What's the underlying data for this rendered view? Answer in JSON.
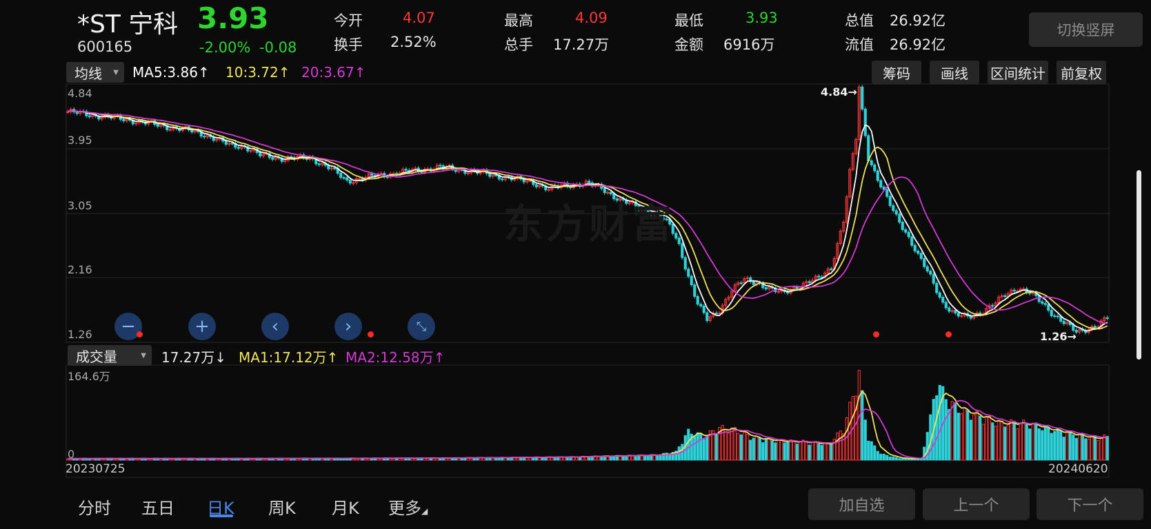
{
  "stock": {
    "name": "*ST 宁科",
    "code": "600165",
    "price": "3.93",
    "change_pct": "-2.00%",
    "change_amt": "-0.08"
  },
  "quote": {
    "open_label": "今开",
    "open": "4.07",
    "high_label": "最高",
    "high": "4.09",
    "low_label": "最低",
    "low": "3.93",
    "mktcap_label": "总值",
    "mktcap": "26.92亿",
    "turnover_label": "换手",
    "turnover": "2.52%",
    "volume_label": "总手",
    "volume": "17.27万",
    "amount_label": "金额",
    "amount": "6916万",
    "float_label": "流值",
    "float_cap": "26.92亿"
  },
  "toolbar": {
    "rotate_label": "切换竖屏",
    "ma_select": "均线",
    "ma5": "MA5:3.86",
    "ma10": "10:3.72",
    "ma20": "20:3.67",
    "chip_label": "筹码",
    "draw_label": "画线",
    "range_label": "区间统计",
    "adjust_label": "前复权"
  },
  "volume_bar": {
    "select": "成交量",
    "current": "17.27万",
    "ma1": "MA1:17.12万",
    "ma2": "MA2:12.58万"
  },
  "axis": {
    "price_ticks": [
      "4.84",
      "3.95",
      "3.05",
      "2.16",
      "1.26"
    ],
    "max_marker": "4.84",
    "min_marker": "1.26",
    "vol_max": "164.6万",
    "vol_zero": "0",
    "date_start": "20230725",
    "date_end": "20240620"
  },
  "watermark": "东方财富",
  "tabs": [
    "分时",
    "五日",
    "日K",
    "周K",
    "月K",
    "更多"
  ],
  "active_tab": "日K",
  "buttons": {
    "add": "加自选",
    "prev": "上一个",
    "next": "下一个"
  },
  "colors": {
    "up": "#ff3838",
    "down": "#2ed1d8",
    "ma5": "#ffffff",
    "ma10": "#f2e35a",
    "ma20": "#d43ad4"
  },
  "chart_data": {
    "type": "candlestick",
    "ylim": [
      1.26,
      4.84
    ],
    "x_range": [
      "20230725",
      "20240620"
    ],
    "close_points": [
      [
        0,
        4.48
      ],
      [
        10,
        4.42
      ],
      [
        20,
        4.36
      ],
      [
        30,
        4.28
      ],
      [
        40,
        4.2
      ],
      [
        45,
        4.14
      ],
      [
        52,
        4.0
      ],
      [
        57,
        3.98
      ],
      [
        62,
        3.85
      ],
      [
        70,
        3.8
      ],
      [
        78,
        3.82
      ],
      [
        85,
        3.65
      ],
      [
        90,
        3.48
      ],
      [
        95,
        3.52
      ],
      [
        100,
        3.56
      ],
      [
        110,
        3.62
      ],
      [
        120,
        3.68
      ],
      [
        130,
        3.62
      ],
      [
        140,
        3.54
      ],
      [
        150,
        3.46
      ],
      [
        155,
        3.36
      ],
      [
        160,
        3.42
      ],
      [
        167,
        3.44
      ],
      [
        172,
        3.38
      ],
      [
        178,
        3.2
      ],
      [
        184,
        3.1
      ],
      [
        190,
        3.0
      ],
      [
        194,
        2.84
      ],
      [
        197,
        2.56
      ],
      [
        200,
        2.1
      ],
      [
        203,
        1.7
      ],
      [
        206,
        1.48
      ],
      [
        210,
        1.62
      ],
      [
        214,
        1.9
      ],
      [
        218,
        2.06
      ],
      [
        222,
        2.02
      ],
      [
        226,
        1.92
      ],
      [
        230,
        1.86
      ],
      [
        234,
        1.94
      ],
      [
        238,
        2.0
      ],
      [
        242,
        2.08
      ],
      [
        246,
        2.24
      ],
      [
        250,
        2.9
      ],
      [
        252,
        3.6
      ],
      [
        254,
        4.1
      ],
      [
        255,
        4.84
      ],
      [
        258,
        3.82
      ],
      [
        262,
        3.4
      ],
      [
        266,
        3.05
      ],
      [
        270,
        2.75
      ],
      [
        274,
        2.4
      ],
      [
        278,
        2.1
      ],
      [
        282,
        1.72
      ],
      [
        286,
        1.54
      ],
      [
        290,
        1.52
      ],
      [
        294,
        1.58
      ],
      [
        298,
        1.68
      ],
      [
        302,
        1.84
      ],
      [
        306,
        1.94
      ],
      [
        310,
        1.86
      ],
      [
        314,
        1.72
      ],
      [
        318,
        1.54
      ],
      [
        322,
        1.4
      ],
      [
        325,
        1.3
      ],
      [
        328,
        1.34
      ],
      [
        332,
        1.4
      ],
      [
        335,
        1.5
      ]
    ],
    "volume_points": [
      [
        0,
        3
      ],
      [
        60,
        3
      ],
      [
        120,
        4
      ],
      [
        160,
        6
      ],
      [
        190,
        10
      ],
      [
        196,
        16
      ],
      [
        200,
        55
      ],
      [
        205,
        45
      ],
      [
        210,
        62
      ],
      [
        215,
        58
      ],
      [
        220,
        44
      ],
      [
        225,
        40
      ],
      [
        230,
        36
      ],
      [
        235,
        36
      ],
      [
        240,
        34
      ],
      [
        245,
        30
      ],
      [
        250,
        60
      ],
      [
        255,
        165
      ],
      [
        258,
        40
      ],
      [
        262,
        12
      ],
      [
        268,
        3
      ],
      [
        275,
        3
      ],
      [
        278,
        80
      ],
      [
        280,
        150
      ],
      [
        284,
        110
      ],
      [
        288,
        95
      ],
      [
        292,
        88
      ],
      [
        296,
        80
      ],
      [
        300,
        70
      ],
      [
        305,
        72
      ],
      [
        310,
        70
      ],
      [
        315,
        60
      ],
      [
        320,
        55
      ],
      [
        325,
        48
      ],
      [
        330,
        42
      ],
      [
        335,
        45
      ]
    ]
  }
}
